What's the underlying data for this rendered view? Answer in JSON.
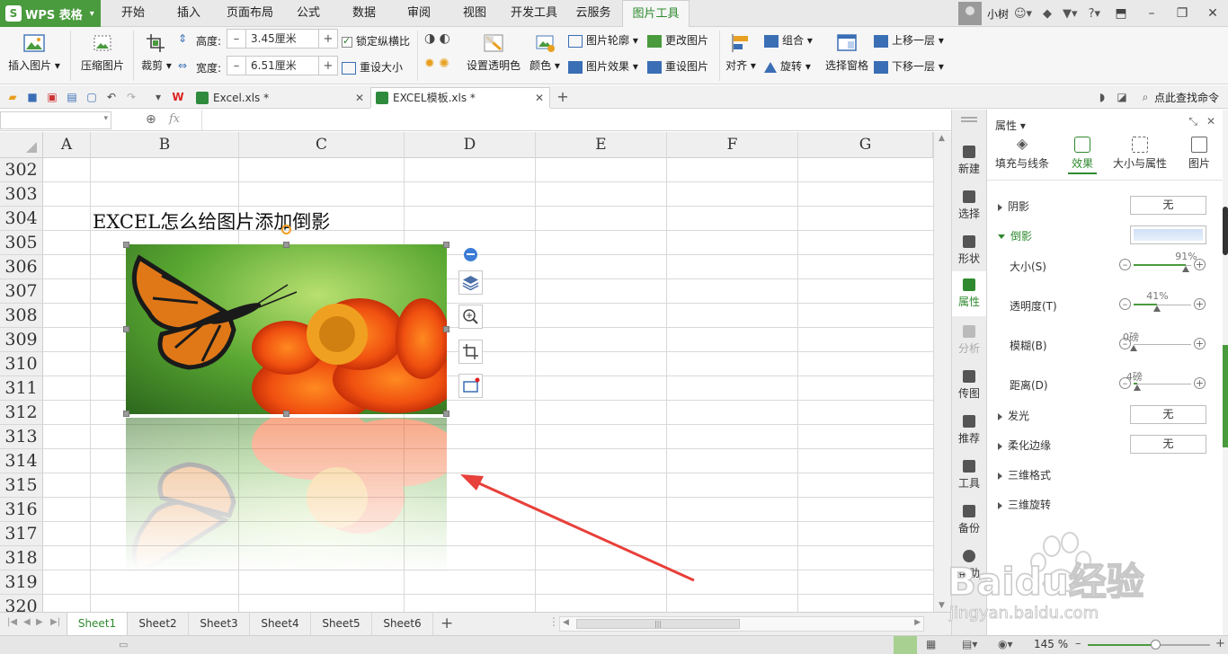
{
  "app": {
    "name": "WPS 表格",
    "logo_letter": "S"
  },
  "menu": {
    "tabs": [
      "开始",
      "插入",
      "页面布局",
      "公式",
      "数据",
      "审阅",
      "视图",
      "开发工具",
      "云服务",
      "图片工具"
    ],
    "active": "图片工具",
    "user": "小树"
  },
  "ribbon": {
    "insert_picture": "插入图片",
    "compress_picture": "压缩图片",
    "crop": "裁剪",
    "height_label": "高度:",
    "height_value": "3.45厘米",
    "width_label": "宽度:",
    "width_value": "6.51厘米",
    "lock_ratio": "锁定纵横比",
    "reset_size": "重设大小",
    "set_transparent": "设置透明色",
    "color": "颜色",
    "picture_outline": "图片轮廓",
    "picture_effects": "图片效果",
    "change_picture": "更改图片",
    "reset_picture": "重设图片",
    "align": "对齐",
    "group": "组合",
    "rotate": "旋转",
    "selection_pane": "选择窗格",
    "bring_forward": "上移一层",
    "send_backward": "下移一层"
  },
  "quick_access": {
    "tabs": [
      {
        "label": "Excel.xls *",
        "active": false
      },
      {
        "label": "EXCEL模板.xls *",
        "active": true
      }
    ],
    "search": "点此查找命令"
  },
  "formula_bar": {
    "fx": "fx"
  },
  "grid": {
    "columns": [
      "A",
      "B",
      "C",
      "D",
      "E",
      "F",
      "G"
    ],
    "rows": [
      "302",
      "303",
      "304",
      "305",
      "306",
      "307",
      "308",
      "309",
      "310",
      "311",
      "312",
      "313",
      "314",
      "315",
      "316",
      "317",
      "318",
      "319",
      "320"
    ],
    "title_cell": "EXCEL怎么给图片添加倒影"
  },
  "sheets": {
    "tabs": [
      "Sheet1",
      "Sheet2",
      "Sheet3",
      "Sheet4",
      "Sheet5",
      "Sheet6"
    ],
    "active": "Sheet1",
    "add": "+"
  },
  "status": {
    "zoom": "145 %"
  },
  "side_strip": {
    "items": [
      "新建",
      "选择",
      "形状",
      "属性",
      "分析",
      "传图",
      "推荐",
      "工具",
      "备份",
      "帮助"
    ],
    "active": "属性",
    "disabled": [
      "分析"
    ]
  },
  "pane": {
    "title": "属性 ▾",
    "tabs": [
      "填充与线条",
      "效果",
      "大小与属性",
      "图片"
    ],
    "active_tab": "效果",
    "sections": {
      "shadow": {
        "label": "阴影",
        "value": "无"
      },
      "reflection": {
        "label": "倒影",
        "size_label": "大小(S)",
        "size_value": "91%",
        "size_fraction": 0.91,
        "transparency_label": "透明度(T)",
        "transparency_value": "41%",
        "transparency_fraction": 0.41,
        "blur_label": "模糊(B)",
        "blur_value": "0磅",
        "blur_fraction": 0.0,
        "distance_label": "距离(D)",
        "distance_value": "4磅",
        "distance_fraction": 0.06
      },
      "glow": {
        "label": "发光",
        "value": "无"
      },
      "soft_edges": {
        "label": "柔化边缘",
        "value": "无"
      },
      "bevel": {
        "label": "三维格式"
      },
      "rotation3d": {
        "label": "三维旋转"
      }
    }
  },
  "watermark": {
    "brand": "Baidu经验",
    "url": "jingyan.baidu.com"
  },
  "colors": {
    "accent": "#4a9a3e",
    "arrow": "#e8403a",
    "selection_blue": "#3b7cd6"
  }
}
